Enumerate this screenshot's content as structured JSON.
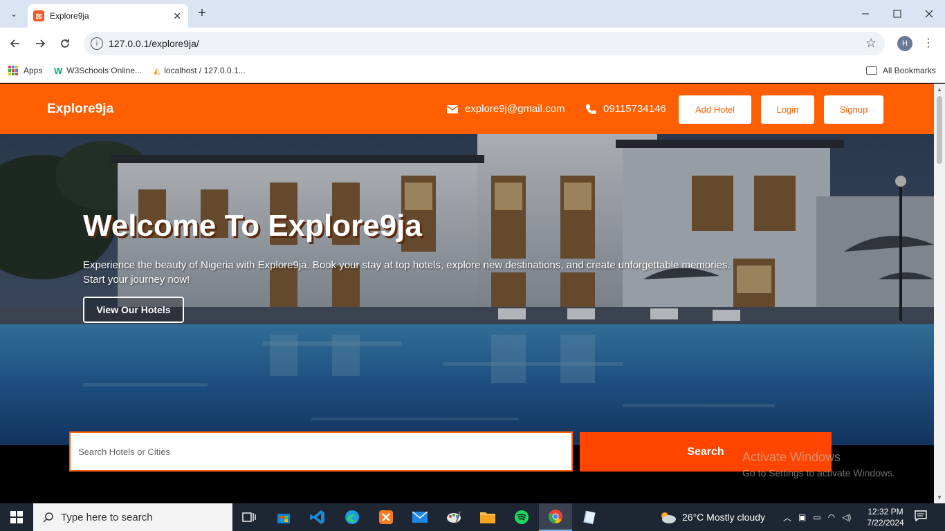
{
  "browser": {
    "tab_title": "Explore9ja",
    "tab_close": "✕",
    "new_tab": "+",
    "url": "127.0.0.1/explore9ja/",
    "profile_initial": "H",
    "bookmarks": {
      "apps": "Apps",
      "w3schools": "W3Schools Online...",
      "localhost": "localhost / 127.0.0.1...",
      "all": "All Bookmarks"
    }
  },
  "site": {
    "brand": "Explore9ja",
    "email": "explore9j@gmail.com",
    "phone": "09115734146",
    "buttons": {
      "add_hotel": "Add Hotel",
      "login": "Login",
      "signup": "Signup"
    },
    "hero": {
      "title": "Welcome To Explore9ja",
      "text": "Experience the beauty of Nigeria with Explore9ja. Book your stay at top hotels, explore new destinations, and create unforgettable memories. Start your journey now!",
      "cta": "View Our Hotels"
    },
    "search": {
      "placeholder": "Search Hotels or Cities",
      "button": "Search"
    },
    "colors": {
      "brand_orange": "#ff5f01",
      "search_button": "#ff4500"
    }
  },
  "watermark": {
    "title": "Activate Windows",
    "subtitle": "Go to Settings to activate Windows."
  },
  "taskbar": {
    "search_placeholder": "Type here to search",
    "weather": "26°C  Mostly cloudy",
    "time": "12:32 PM",
    "date": "7/22/2024"
  }
}
